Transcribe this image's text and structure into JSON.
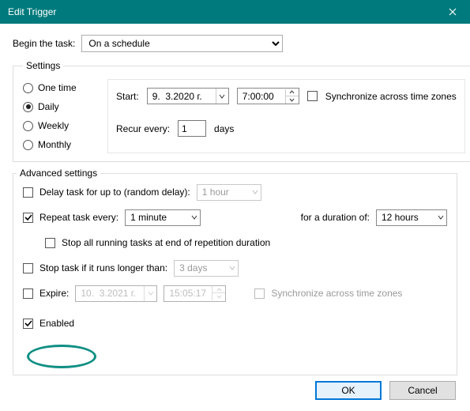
{
  "window": {
    "title": "Edit Trigger"
  },
  "begin": {
    "label": "Begin the task:",
    "value": "On a schedule"
  },
  "settings": {
    "legend": "Settings",
    "radios": {
      "one_time": "One time",
      "daily": "Daily",
      "weekly": "Weekly",
      "monthly": "Monthly",
      "selected": "daily"
    },
    "start_label": "Start:",
    "date": "9.  3.2020 г.",
    "time": "7:00:00",
    "sync_tz": "Synchronize across time zones",
    "recur_pre": "Recur every:",
    "recur_val": "1",
    "recur_post": "days"
  },
  "advanced": {
    "legend": "Advanced settings",
    "delay_label": "Delay task for up to (random delay):",
    "delay_val": "1 hour",
    "repeat_label": "Repeat task every:",
    "repeat_val": "1 minute",
    "duration_label": "for a duration of:",
    "duration_val": "12 hours",
    "stop_at_end": "Stop all running tasks at end of repetition duration",
    "stop_longer_label": "Stop task if it runs longer than:",
    "stop_longer_val": "3 days",
    "expire_label": "Expire:",
    "expire_date": "10.  3.2021 г.",
    "expire_time": "15:05:17",
    "sync_tz2": "Synchronize across time zones",
    "enabled_label": "Enabled"
  },
  "buttons": {
    "ok": "OK",
    "cancel": "Cancel"
  }
}
